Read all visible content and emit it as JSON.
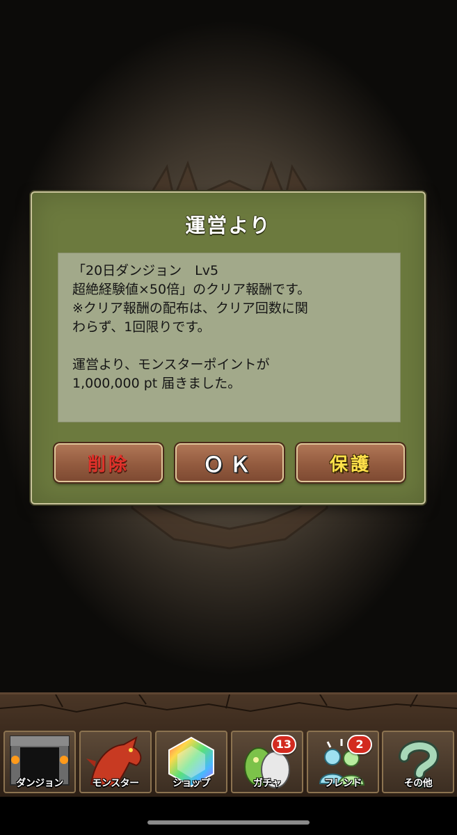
{
  "dialog": {
    "title": "運営より",
    "message_lines": [
      "「20日ダンジョン　Lv5",
      "超絶経験値×50倍」のクリア報酬です。",
      "※クリア報酬の配布は、クリア回数に関",
      "わらず、1回限りです。",
      "",
      "運営より、モンスターポイントが",
      "1,000,000 pt 届きました。"
    ],
    "buttons": {
      "delete": "削除",
      "ok": "ＯＫ",
      "protect": "保護"
    }
  },
  "nav": {
    "items": [
      {
        "label": "ダンジョン",
        "icon": "dungeon-gate-icon"
      },
      {
        "label": "モンスター",
        "icon": "red-dragon-icon"
      },
      {
        "label": "ショップ",
        "icon": "rainbow-gem-icon"
      },
      {
        "label": "ガチャ",
        "icon": "egg-icon",
        "badge": "13"
      },
      {
        "label": "フレンド",
        "icon": "friends-icon",
        "badge": "2"
      },
      {
        "label": "その他",
        "icon": "question-mark-icon"
      }
    ]
  },
  "colors": {
    "dialog_bg": "#6c7a3e",
    "message_bg": "#a2a98a",
    "button_bg": "#935b3f",
    "delete_text": "#e0312a",
    "protect_text": "#ffe14a",
    "badge": "#d32a1f"
  }
}
